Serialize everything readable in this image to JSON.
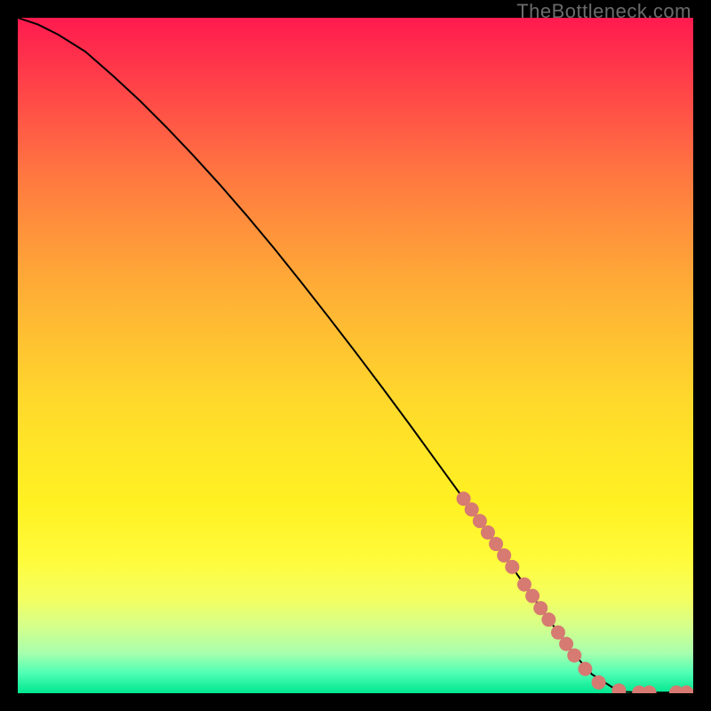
{
  "watermark": "TheBottleneck.com",
  "colors": {
    "dot_fill": "#d67a72",
    "line_stroke": "#000000",
    "gradient_top": "#ff1a4f",
    "gradient_bottom": "#00e68f",
    "frame": "#000000"
  },
  "chart_data": {
    "type": "line",
    "title": "",
    "xlabel": "",
    "ylabel": "",
    "xlim": [
      0,
      100
    ],
    "ylim": [
      0,
      100
    ],
    "grid": false,
    "legend": false,
    "series": [
      {
        "name": "curve",
        "x": [
          0,
          3,
          6,
          10,
          14,
          18,
          22,
          26,
          30,
          34,
          38,
          42,
          46,
          50,
          54,
          58,
          62,
          66,
          70,
          74,
          78,
          82,
          85,
          88,
          90,
          92,
          94,
          96,
          98,
          100
        ],
        "values": [
          100,
          99,
          97.5,
          95,
          91.5,
          87.8,
          83.8,
          79.6,
          75.2,
          70.6,
          65.8,
          60.8,
          55.7,
          50.5,
          45.2,
          39.8,
          34.3,
          28.8,
          23.2,
          17.5,
          11.8,
          6.2,
          2.8,
          0.9,
          0.2,
          0.1,
          0.1,
          0.1,
          0.1,
          0.1
        ]
      }
    ],
    "dots": [
      {
        "x": 66.0,
        "y": 28.8
      },
      {
        "x": 67.2,
        "y": 27.2
      },
      {
        "x": 68.4,
        "y": 25.5
      },
      {
        "x": 69.6,
        "y": 23.8
      },
      {
        "x": 70.8,
        "y": 22.1
      },
      {
        "x": 72.0,
        "y": 20.4
      },
      {
        "x": 73.2,
        "y": 18.7
      },
      {
        "x": 75.0,
        "y": 16.1
      },
      {
        "x": 76.2,
        "y": 14.4
      },
      {
        "x": 77.4,
        "y": 12.6
      },
      {
        "x": 78.6,
        "y": 10.9
      },
      {
        "x": 80.0,
        "y": 9.0
      },
      {
        "x": 81.2,
        "y": 7.3
      },
      {
        "x": 82.4,
        "y": 5.6
      },
      {
        "x": 84.0,
        "y": 3.6
      },
      {
        "x": 86.0,
        "y": 1.6
      },
      {
        "x": 89.0,
        "y": 0.4
      },
      {
        "x": 92.0,
        "y": 0.1
      },
      {
        "x": 93.5,
        "y": 0.1
      },
      {
        "x": 97.5,
        "y": 0.1
      },
      {
        "x": 99.0,
        "y": 0.1
      }
    ]
  }
}
